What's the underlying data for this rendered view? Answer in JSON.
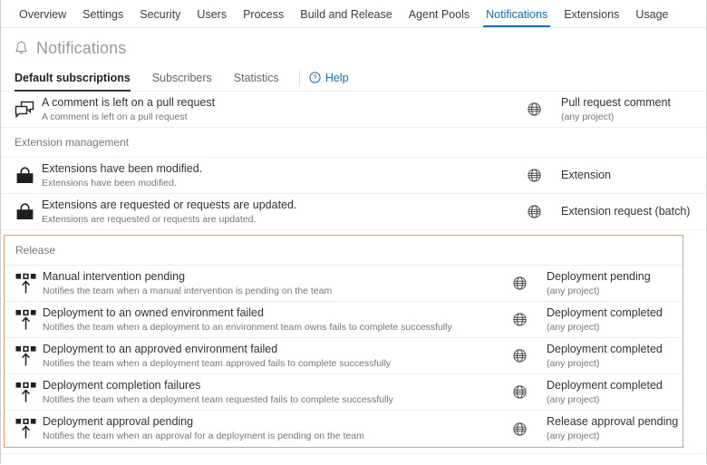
{
  "topnav": {
    "items": [
      {
        "label": "Overview",
        "active": false
      },
      {
        "label": "Settings",
        "active": false
      },
      {
        "label": "Security",
        "active": false
      },
      {
        "label": "Users",
        "active": false
      },
      {
        "label": "Process",
        "active": false
      },
      {
        "label": "Build and Release",
        "active": false
      },
      {
        "label": "Agent Pools",
        "active": false
      },
      {
        "label": "Notifications",
        "active": true
      },
      {
        "label": "Extensions",
        "active": false
      },
      {
        "label": "Usage",
        "active": false
      }
    ],
    "active_color": "#106ebe"
  },
  "header": {
    "title": "Notifications",
    "icon": "bell-icon"
  },
  "pivot": {
    "items": [
      {
        "label": "Default subscriptions",
        "active": true
      },
      {
        "label": "Subscribers",
        "active": false
      },
      {
        "label": "Statistics",
        "active": false
      }
    ],
    "help_label": "Help",
    "help_icon": "question-circle-icon",
    "help_color": "#106ebe"
  },
  "colors": {
    "highlight_border": "#e8a061",
    "link": "#106ebe",
    "text": "#333333",
    "muted": "#767676"
  },
  "groups": [
    {
      "name": "code-group",
      "header": null,
      "highlighted": false,
      "rows": [
        {
          "icon": "pull-request-comment-icon",
          "title": "A comment is left on a pull request",
          "desc": "A comment is left on a pull request",
          "scope_icon": "globe-icon",
          "right_title": "Pull request comment",
          "right_sub": "(any project)"
        }
      ]
    },
    {
      "name": "extension-management-group",
      "header": "Extension management",
      "highlighted": false,
      "rows": [
        {
          "icon": "extension-bag-icon",
          "title": "Extensions have been modified.",
          "desc": "Extensions have been modified.",
          "scope_icon": "globe-icon",
          "right_title": "Extension",
          "right_sub": ""
        },
        {
          "icon": "extension-bag-icon",
          "title": "Extensions are requested or requests are updated.",
          "desc": "Extensions are requested or requests are updated.",
          "scope_icon": "globe-icon",
          "right_title": "Extension request (batch)",
          "right_sub": ""
        }
      ]
    },
    {
      "name": "release-group",
      "header": "Release",
      "highlighted": true,
      "rows": [
        {
          "icon": "release-deployment-icon",
          "title": "Manual intervention pending",
          "desc": "Notifies the team when a manual intervention is pending on the team",
          "scope_icon": "globe-icon",
          "right_title": "Deployment pending",
          "right_sub": "(any project)"
        },
        {
          "icon": "release-deployment-icon",
          "title": "Deployment to an owned environment failed",
          "desc": "Notifies the team when a deployment to an environment team owns fails to complete successfully",
          "scope_icon": "globe-icon",
          "right_title": "Deployment completed",
          "right_sub": "(any project)"
        },
        {
          "icon": "release-deployment-icon",
          "title": "Deployment to an approved environment failed",
          "desc": "Notifies the team when a deployment team approved fails to complete successfully",
          "scope_icon": "globe-icon",
          "right_title": "Deployment completed",
          "right_sub": "(any project)"
        },
        {
          "icon": "release-deployment-icon",
          "title": "Deployment completion failures",
          "desc": "Notifies the team when a deployment team requested fails to complete successfully",
          "scope_icon": "globe-icon",
          "right_title": "Deployment completed",
          "right_sub": "(any project)"
        },
        {
          "icon": "release-deployment-icon",
          "title": "Deployment approval pending",
          "desc": "Notifies the team when an approval for a deployment is pending on the team",
          "scope_icon": "globe-icon",
          "right_title": "Release approval pending",
          "right_sub": "(any project)"
        }
      ]
    }
  ]
}
